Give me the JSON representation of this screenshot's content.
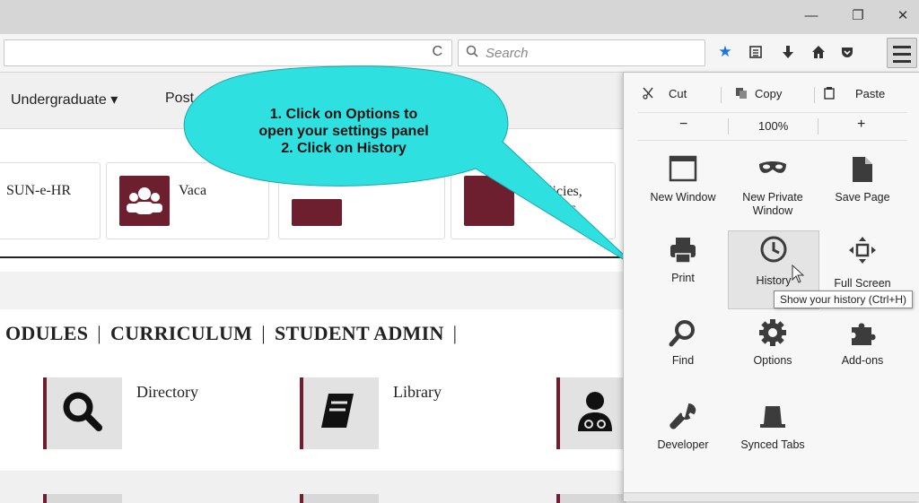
{
  "window": {
    "minimize": "—",
    "restore": "❐",
    "close": "✕"
  },
  "toolbar": {
    "reload_icon": "C",
    "search_placeholder": "Search",
    "icons": [
      "star-icon",
      "reading-list-icon",
      "download-icon",
      "home-icon",
      "pocket-icon",
      "hamburger-menu-icon"
    ]
  },
  "page": {
    "nav": [
      "Undergraduate ▾",
      "Post"
    ],
    "cards": [
      {
        "label": "SUN-e-HR"
      },
      {
        "label": "Vaca"
      },
      {
        "label": ""
      },
      {
        "label": "licies,\nlures"
      }
    ],
    "tabs": [
      "ODULES",
      "CURRICULUM",
      "STUDENT ADMIN"
    ],
    "tiles": [
      {
        "label": "Directory"
      },
      {
        "label": "Library"
      },
      {
        "label": ""
      }
    ]
  },
  "callout": {
    "line1": "1. Click on Options to",
    "line2": "open your settings panel",
    "line3": "2. Click on History"
  },
  "menu": {
    "cut": "Cut",
    "copy": "Copy",
    "paste": "Paste",
    "zoom_out": "−",
    "zoom_level": "100%",
    "zoom_in": "+",
    "items": [
      {
        "label": "New Window",
        "icon": "new-window-icon"
      },
      {
        "label": "New Private Window",
        "icon": "private-mask-icon"
      },
      {
        "label": "Save Page",
        "icon": "save-page-icon"
      },
      {
        "label": "Print",
        "icon": "print-icon"
      },
      {
        "label": "History",
        "icon": "history-clock-icon"
      },
      {
        "label": "Full Screen",
        "icon": "full-screen-icon"
      },
      {
        "label": "Find",
        "icon": "find-icon"
      },
      {
        "label": "Options",
        "icon": "options-gear-icon"
      },
      {
        "label": "Add-ons",
        "icon": "addons-puzzle-icon"
      },
      {
        "label": "Developer",
        "icon": "developer-wrench-icon"
      },
      {
        "label": "Synced Tabs",
        "icon": "synced-tabs-icon"
      }
    ],
    "tooltip": "Show your history (Ctrl+H)"
  },
  "colors": {
    "accent": "#6d1f2f",
    "callout": "#2ee0e0"
  }
}
